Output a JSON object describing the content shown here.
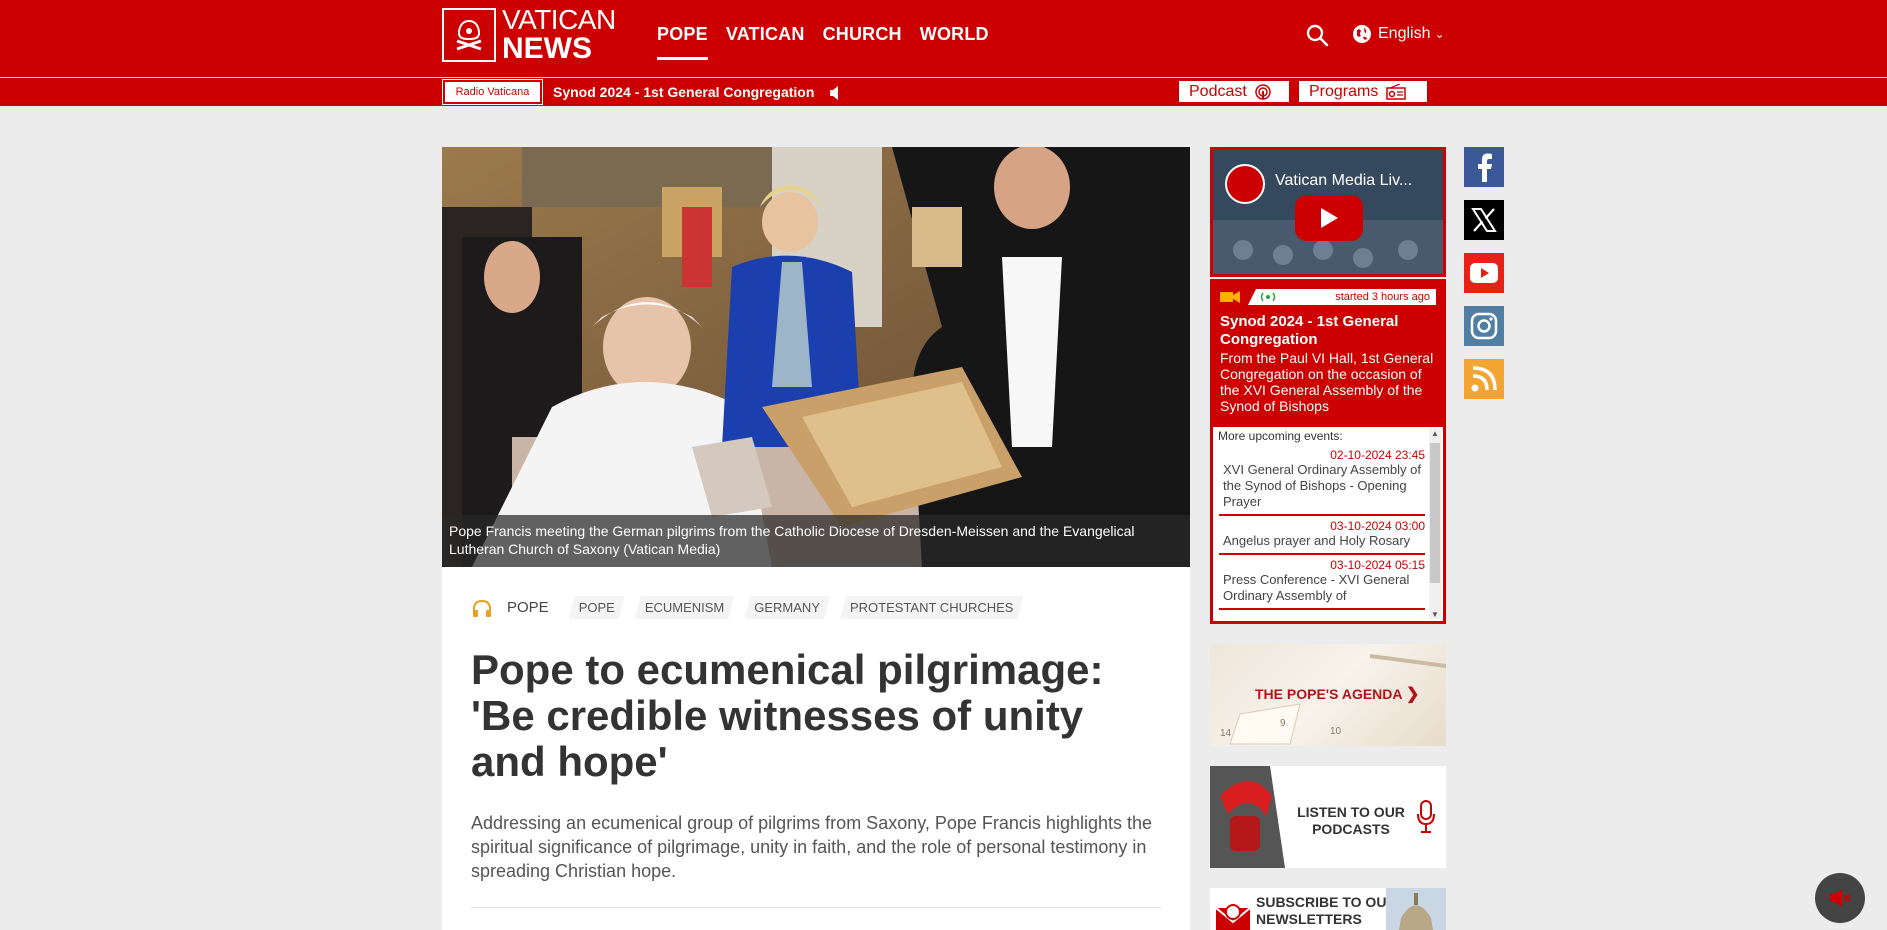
{
  "header": {
    "logo_line1": "VATICAN",
    "logo_line2": "NEWS",
    "nav": [
      "POPE",
      "VATICAN",
      "CHURCH",
      "WORLD"
    ],
    "language": "English"
  },
  "subbar": {
    "radio_label": "Radio Vaticana",
    "live_title": "Synod 2024 - 1st General Congregation",
    "podcast_label": "Podcast",
    "programs_label": "Programs"
  },
  "article": {
    "caption": "Pope Francis meeting the German pilgrims from the Catholic Diocese of Dresden-Meissen and the Evangelical Lutheran Church of Saxony   (Vatican Media)",
    "section": "POPE",
    "tags": [
      "POPE",
      "ECUMENISM",
      "GERMANY",
      "PROTESTANT CHURCHES"
    ],
    "headline": "Pope to ecumenical pilgrimage: 'Be credible witnesses of unity and hope'",
    "lede": "Addressing an ecumenical group of pilgrims from Saxony, Pope Francis highlights the spiritual significance of pilgrimage, unity in faith, and the role of personal testimony in spreading Christian hope."
  },
  "sidebar": {
    "video_title": "Vatican Media Liv...",
    "live": {
      "started": "started 3 hours ago",
      "title": "Synod 2024 - 1st General Congregation",
      "description": "From the Paul VI Hall, 1st General Congregation on the occasion of the XVI General Assembly of the Synod of Bishops"
    },
    "upcoming_header": "More upcoming events:",
    "events": [
      {
        "date": "02-10-2024 23:45",
        "title": "XVI General Ordinary Assembly of the Synod of Bishops - Opening Prayer"
      },
      {
        "date": "03-10-2024 03:00",
        "title": "Angelus prayer and Holy Rosary"
      },
      {
        "date": "03-10-2024 05:15",
        "title": "Press Conference - XVI General Ordinary Assembly of"
      }
    ],
    "agenda_label": "THE POPE'S AGENDA",
    "podcasts_label": "LISTEN TO OUR PODCASTS",
    "newsletter_label": "SUBSCRIBE TO OUR NEWSLETTERS"
  },
  "social": [
    "facebook-icon",
    "x-icon",
    "youtube-icon",
    "instagram-icon",
    "rss-icon"
  ],
  "colors": {
    "brand_red": "#cc0000",
    "facebook": "#3b5998",
    "x": "#000000",
    "youtube": "#e62117",
    "instagram": "#517fa4",
    "rss": "#f4a433"
  }
}
